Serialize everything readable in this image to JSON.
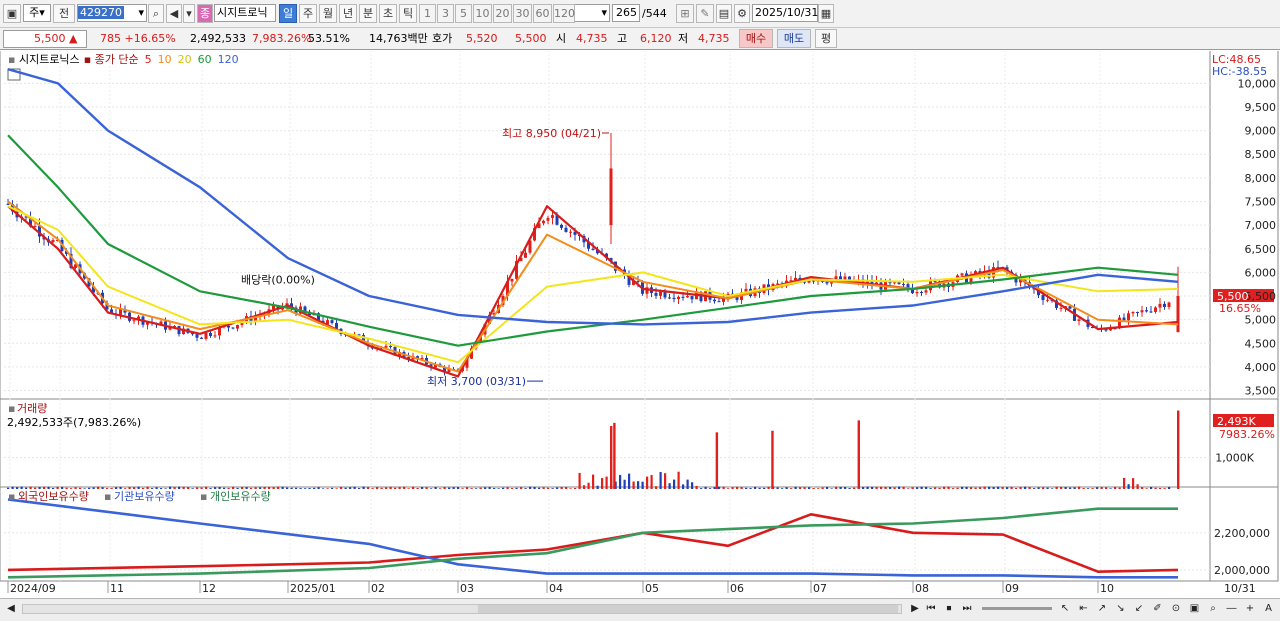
{
  "toolbar": {
    "market": "주",
    "market_btn": "전",
    "code": "429270",
    "name_badge": "종",
    "name": "시지트로닉",
    "periods": [
      "일",
      "주",
      "월",
      "년",
      "분",
      "초",
      "틱"
    ],
    "active_period": "일",
    "intervals": [
      "1",
      "3",
      "5",
      "10",
      "20",
      "30",
      "60",
      "120"
    ],
    "count": "265",
    "total": "/544",
    "date": "2025/10/31"
  },
  "quote": {
    "price": "5,500",
    "arrow": "▲",
    "change": "785",
    "change_pct": "+16.65%",
    "volume": "2,492,533",
    "vol_ratio": "7,983.26%",
    "turnover": "53.51%",
    "amount": "14,763백만",
    "hoga_label": "호가",
    "ask": "5,520",
    "bid": "5,500",
    "open_label": "시",
    "open": "4,735",
    "high_label": "고",
    "high": "6,120",
    "low_label": "저",
    "low": "4,735",
    "buy": "매수",
    "sell": "매도",
    "eval": "평"
  },
  "price_panel": {
    "title": "시지트로닉스",
    "ma_label": "종가 단순",
    "ma_periods": [
      "5",
      "10",
      "20",
      "60",
      "120"
    ],
    "lc": "LC:48.65",
    "hc": "HC:-38.55",
    "current_price": "5,500",
    "current_pct": "16.65%",
    "high_note": "최고 8,950 (04/21)",
    "low_note": "최저 3,700 (03/31)",
    "dividend_note": "배당락(0.00%)"
  },
  "volume_panel": {
    "title": "거래량",
    "value": "2,492,533주(7,983.26%)",
    "badge": "2,493K",
    "badge_pct": "7983.26%"
  },
  "holding_panel": {
    "series": [
      "외국인보유수량",
      "기관보유수량",
      "개인보유수량"
    ]
  },
  "xaxis": {
    "labels": [
      "2024/09",
      "11",
      "12",
      "2025/01",
      "02",
      "03",
      "04",
      "05",
      "06",
      "07",
      "08",
      "09",
      "10"
    ],
    "right_label": "10/31"
  },
  "colors": {
    "up": "#e0201b",
    "down": "#1f3fb8",
    "ma5": "#d81b1b",
    "ma10": "#f28c1a",
    "ma20": "#f2e61a",
    "ma60": "#1e9a3c",
    "ma120": "#3a63d8",
    "foreign": "#d81b1b",
    "institution": "#3a63d8",
    "individual": "#3a9a5e"
  },
  "chart_data": [
    {
      "type": "candlestick",
      "title": "시지트로닉스",
      "ylim": [
        3300,
        10600
      ],
      "yticks": [
        3500,
        4000,
        4500,
        5000,
        5500,
        6000,
        6500,
        7000,
        7500,
        8000,
        8500,
        9000,
        9500,
        10000
      ],
      "grid": true,
      "legend": "top-left",
      "x": [
        "2024/09",
        "2024/10",
        "2024/11",
        "2024/12",
        "2025/01",
        "2025/02",
        "2025/03",
        "2025/04",
        "2025/05",
        "2025/06",
        "2025/07",
        "2025/08",
        "2025/09",
        "2025/10",
        "2025/10/31"
      ],
      "close": [
        7450,
        6550,
        5200,
        4650,
        5300,
        4500,
        3850,
        7300,
        5600,
        5450,
        5900,
        5650,
        6050,
        4750,
        5500
      ],
      "series": [
        {
          "name": "5",
          "values": [
            7400,
            6500,
            5150,
            4700,
            5300,
            4450,
            3800,
            7400,
            5650,
            5450,
            5900,
            5650,
            6100,
            4800,
            4950
          ]
        },
        {
          "name": "10",
          "values": [
            7500,
            6700,
            5300,
            4800,
            5200,
            4500,
            3900,
            6800,
            5800,
            5450,
            5850,
            5650,
            6050,
            5000,
            4900
          ]
        },
        {
          "name": "20",
          "values": [
            7400,
            6900,
            5700,
            4900,
            5000,
            4600,
            4100,
            5700,
            6000,
            5500,
            5850,
            5800,
            5950,
            5600,
            5650
          ]
        },
        {
          "name": "60",
          "values": [
            8900,
            7800,
            6600,
            5600,
            5250,
            4850,
            4450,
            4750,
            5000,
            5250,
            5500,
            5650,
            5850,
            6100,
            5950
          ]
        },
        {
          "name": "120",
          "values": [
            10300,
            10000,
            9000,
            7800,
            6300,
            5500,
            5100,
            4950,
            4900,
            4950,
            5150,
            5300,
            5600,
            5950,
            5800
          ]
        }
      ],
      "annotations": [
        "최고 8,950 (04/21)",
        "최저 3,700 (03/31)",
        "배당락(0.00%)"
      ]
    },
    {
      "type": "bar",
      "title": "거래량",
      "yticks": [
        1000000
      ],
      "ytick_labels": [
        "1,000K"
      ],
      "x": [
        "2025/04/21",
        "2025/04/22",
        "2025/05/27",
        "2025/06/17",
        "2025/07/15",
        "2025/10/31"
      ],
      "values": [
        2000000,
        2100000,
        1800000,
        1850000,
        2180000,
        2493000
      ]
    },
    {
      "type": "line",
      "title": "보유수량",
      "yticks": [
        2000000,
        2200000
      ],
      "ytick_labels": [
        "2,000,000",
        "2,200,000"
      ],
      "x": [
        "2024/09",
        "2024/12",
        "2025/02",
        "2025/03",
        "2025/04",
        "2025/05",
        "2025/06",
        "2025/07",
        "2025/08",
        "2025/09",
        "2025/10",
        "2025/10/31"
      ],
      "series": [
        {
          "name": "외국인보유수량",
          "values": [
            2000000,
            2020000,
            2040000,
            2080000,
            2110000,
            2200000,
            2130000,
            2300000,
            2200000,
            2190000,
            1990000,
            2000000
          ]
        },
        {
          "name": "기관보유수량",
          "values": [
            2380000,
            2250000,
            2140000,
            2030000,
            1980000,
            1980000,
            1980000,
            1980000,
            1970000,
            1970000,
            1960000,
            1960000
          ]
        },
        {
          "name": "개인보유수량",
          "values": [
            1960000,
            1980000,
            2010000,
            2060000,
            2090000,
            2200000,
            2220000,
            2240000,
            2250000,
            2280000,
            2330000,
            2330000
          ]
        }
      ]
    }
  ]
}
